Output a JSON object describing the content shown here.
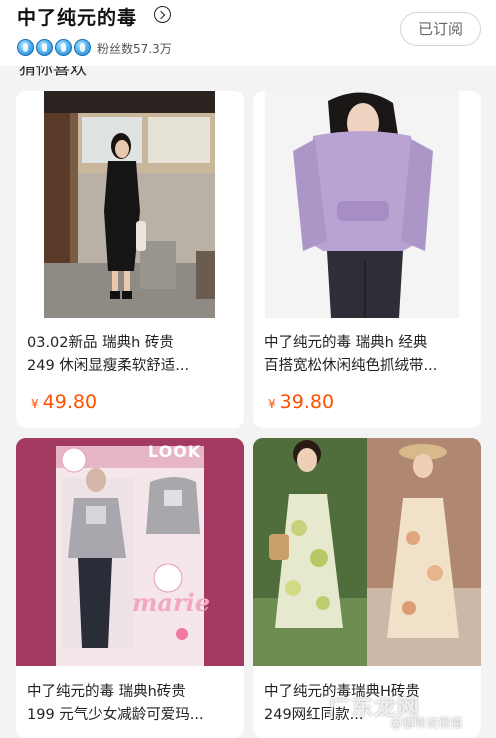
{
  "header": {
    "shop_name": "中了纯元的毒",
    "fans": "粉丝数57.3万",
    "follow_label": "已订阅",
    "level_icon_count": 4
  },
  "section_title": "猜你喜欢",
  "products": [
    {
      "title_line1": "03.02新品 瑞典h 砖贵",
      "title_line2": "249 休闲显瘦柔软舒适...",
      "currency": "¥",
      "price": "49.80"
    },
    {
      "title_line1": "中了纯元的毒 瑞典h 经典",
      "title_line2": "百搭宽松休闲纯色抓绒带...",
      "currency": "¥",
      "price": "39.80"
    },
    {
      "title_line1": "中了纯元的毒 瑞典h砖贵",
      "title_line2": "199 元气少女减龄可爱玛...",
      "photo_text_look": "LOOK",
      "photo_text_marie": "marie"
    },
    {
      "title_line1": "中了纯元的毒瑞典H砖贵",
      "title_line2": "249网红同款..."
    }
  ],
  "watermark": {
    "main": "广东龙网",
    "sub": "@猫咪说很懂"
  },
  "colors": {
    "price": "#ff5000",
    "background": "#f3f3f3",
    "card": "#ffffff"
  }
}
